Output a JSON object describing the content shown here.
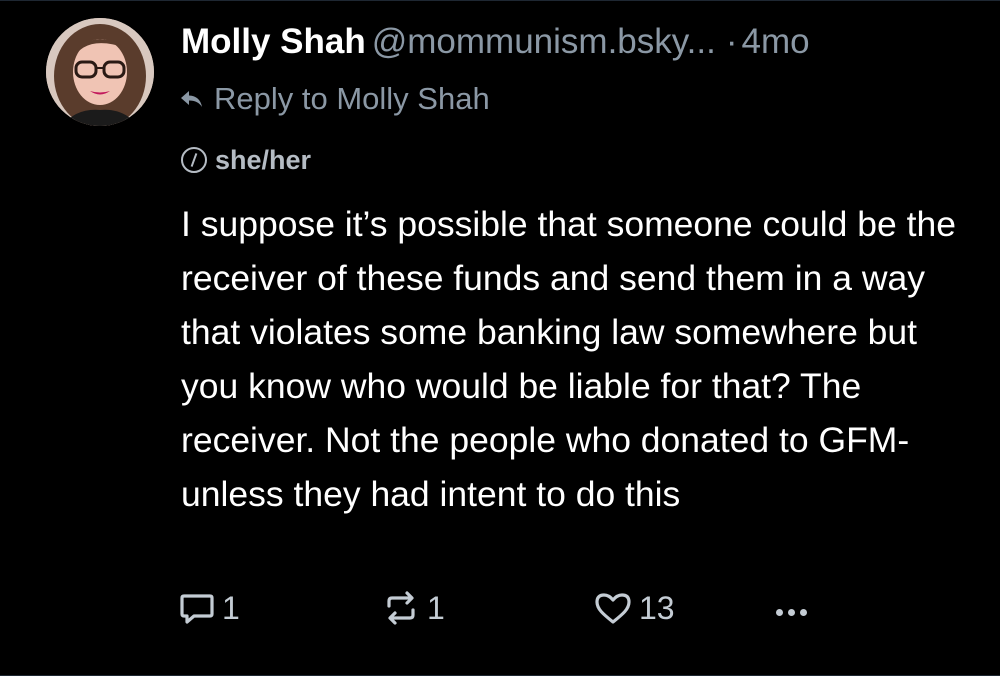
{
  "post": {
    "author_name": "Molly Shah",
    "author_handle": "@mommunism.bsky...",
    "separator": "·",
    "time_ago": "4mo",
    "reply_to_label": "Reply to Molly Shah",
    "pronouns": "she/her",
    "text": "I suppose it’s possible that someone could be the receiver of these funds and send them in a way that violates some banking law somewhere but you know who would be liable for that? The receiver. Not the people who donated to GFM- unless they had intent to do this",
    "reply_count": "1",
    "repost_count": "1",
    "like_count": "13"
  },
  "icons": {
    "reply": "comment-icon",
    "repost": "repost-icon",
    "like": "heart-icon",
    "more": "more-options-icon",
    "reply_to": "reply-arrow-icon",
    "pronouns": "pronoun-icon"
  },
  "colors": {
    "background": "#000000",
    "text_primary": "#ffffff",
    "text_secondary": "#8b98a5",
    "icon": "#c4ccd4"
  }
}
